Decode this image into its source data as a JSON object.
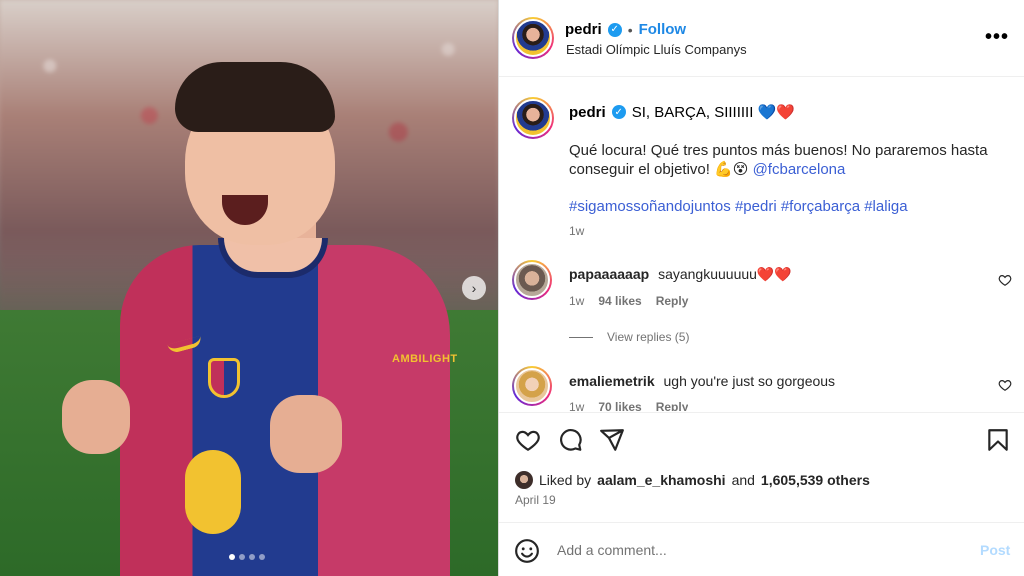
{
  "media": {
    "sleeve_text": "AMBILIGHT",
    "carousel_dots": [
      true,
      false,
      false,
      false
    ]
  },
  "header": {
    "username": "pedri",
    "separator": "•",
    "follow_label": "Follow",
    "location": "Estadi Olímpic Lluís Companys",
    "more_label": "•••"
  },
  "caption": {
    "username": "pedri",
    "headline": "SI, BARÇA, SIIIIIII 💙❤️",
    "body_text": "Qué locura! Qué tres puntos más buenos! No pararemos hasta conseguir el objetivo! 💪😵",
    "mention": "@fcbarcelona",
    "hashtags": [
      "#sigamossoñandojuntos",
      "#pedri",
      "#forçabarça",
      "#laliga"
    ],
    "time": "1w"
  },
  "comments": [
    {
      "username": "papaaaaaap",
      "text": "sayangkuuuuuu❤️❤️",
      "time": "1w",
      "likes": "94 likes",
      "reply_label": "Reply"
    },
    {
      "username": "emaliemetrik",
      "text": "ugh you're just so gorgeous",
      "time": "1w",
      "likes": "70 likes",
      "reply_label": "Reply"
    }
  ],
  "view_replies": "View replies (5)",
  "likes": {
    "prefix": "Liked by",
    "user": "aalam_e_khamoshi",
    "connector": "and",
    "others": "1,605,539 others"
  },
  "date": "April 19",
  "comment_bar": {
    "placeholder": "Add a comment...",
    "post_label": "Post"
  },
  "icons": {
    "verified": "verified-badge-icon",
    "like": "heart-icon",
    "comment": "comment-icon",
    "share": "share-icon",
    "save": "bookmark-icon",
    "emoji": "emoji-icon",
    "next": "chevron-right-icon"
  },
  "colors": {
    "link_blue": "#1e88e5",
    "hashtag_blue": "#3b5fd4",
    "verified_blue": "#1d9bf0",
    "post_disabled": "#b3dbff"
  }
}
